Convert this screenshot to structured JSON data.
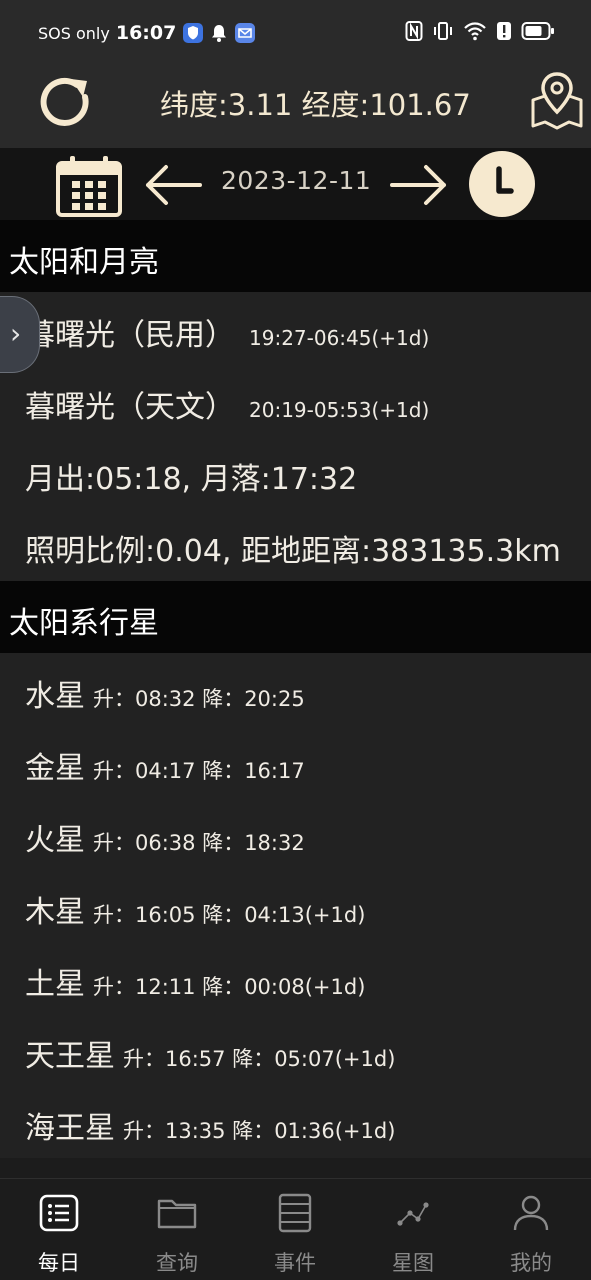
{
  "status_bar": {
    "carrier": "SOS only",
    "time": "16:07"
  },
  "header": {
    "coordinates": "纬度:3.11 经度:101.67"
  },
  "date_bar": {
    "date": "2023-12-11"
  },
  "sun_moon": {
    "title": "太阳和月亮",
    "civil_twilight_label": "暮曙光（民用）",
    "civil_twilight_time": "19:27-06:45(+1d)",
    "astro_twilight_label": "暮曙光（天文）",
    "astro_twilight_time": "20:19-05:53(+1d)",
    "moonrise_moonset": "月出:05:18, 月落:17:32",
    "illumination_distance": "照明比例:0.04, 距地距离:383135.3km"
  },
  "planets": {
    "title": "太阳系行星",
    "items": [
      {
        "name": "水星",
        "times": "升：08:32 降：20:25"
      },
      {
        "name": "金星",
        "times": "升：04:17 降：16:17"
      },
      {
        "name": "火星",
        "times": "升：06:38 降：18:32"
      },
      {
        "name": "木星",
        "times": "升：16:05 降：04:13(+1d)"
      },
      {
        "name": "土星",
        "times": "升：12:11 降：00:08(+1d)"
      },
      {
        "name": "天王星",
        "times": "升：16:57 降：05:07(+1d)"
      },
      {
        "name": "海王星",
        "times": "升：13:35 降：01:36(+1d)"
      }
    ]
  },
  "side_tab": {
    "glyph": "›"
  },
  "bottom_nav": {
    "items": [
      {
        "label": "每日",
        "icon": "list-icon",
        "active": true
      },
      {
        "label": "查询",
        "icon": "folder-icon",
        "active": false
      },
      {
        "label": "事件",
        "icon": "document-icon",
        "active": false
      },
      {
        "label": "星图",
        "icon": "star-chart-icon",
        "active": false
      },
      {
        "label": "我的",
        "icon": "person-icon",
        "active": false
      }
    ]
  },
  "colors": {
    "accent": "#f6e9cf",
    "background": "#1c1c1c",
    "section_header": "#060606"
  }
}
